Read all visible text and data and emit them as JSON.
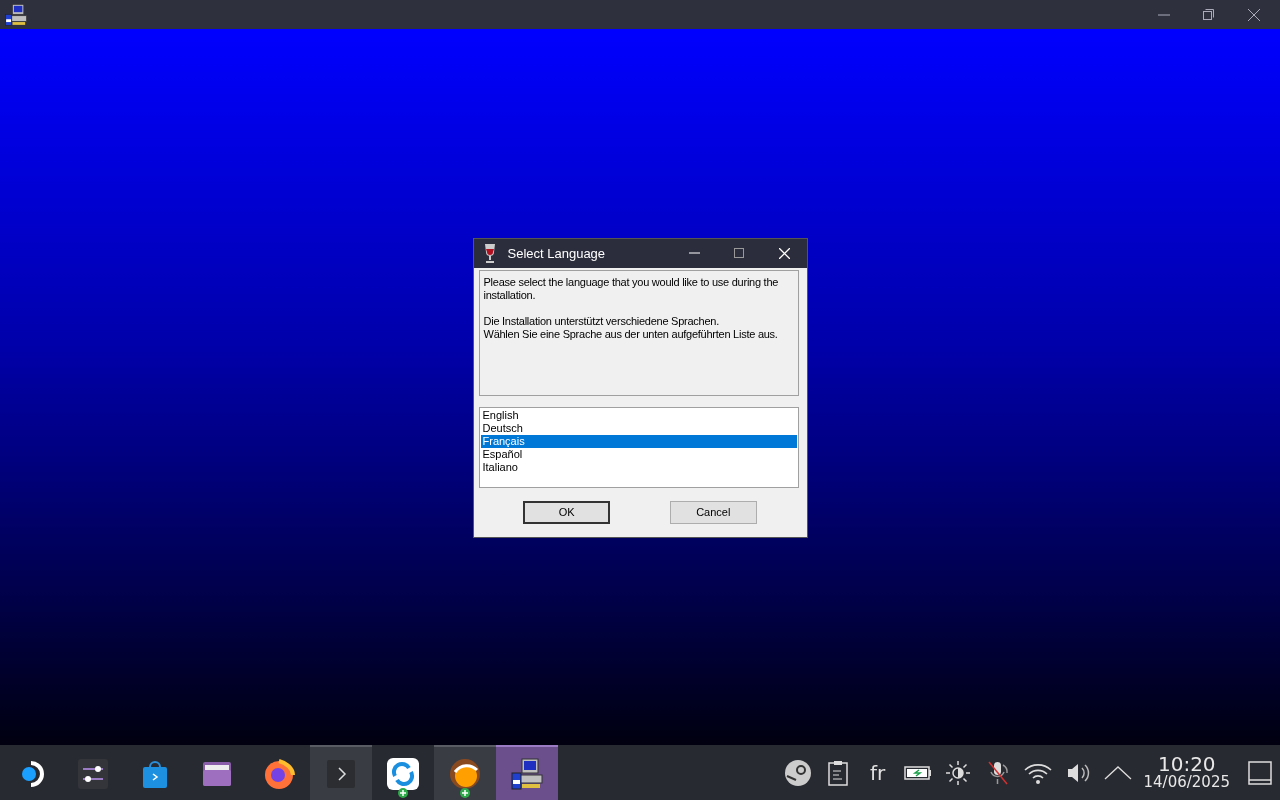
{
  "dialog": {
    "title": "Select Language",
    "message": [
      "Please select the language that you would like to use during the installation.",
      "Die Installation unterstützt verschiedene Sprachen.\nWählen Sie eine Sprache aus der unten aufgeführten Liste aus."
    ],
    "languages": [
      {
        "label": "English",
        "selected": false
      },
      {
        "label": "Deutsch",
        "selected": false
      },
      {
        "label": "Français",
        "selected": true
      },
      {
        "label": "Español",
        "selected": false
      },
      {
        "label": "Italiano",
        "selected": false
      }
    ],
    "buttons": [
      {
        "label": "OK",
        "default": true
      },
      {
        "label": "Cancel",
        "default": false
      }
    ]
  },
  "taskbar": {
    "apps": [
      {
        "kind": "launcher",
        "selected": false,
        "highlighted": false,
        "badge": false
      },
      {
        "kind": "settings",
        "selected": false,
        "highlighted": false,
        "badge": false
      },
      {
        "kind": "store",
        "selected": false,
        "highlighted": false,
        "badge": false
      },
      {
        "kind": "folder",
        "selected": false,
        "highlighted": false,
        "badge": false
      },
      {
        "kind": "browser",
        "selected": false,
        "highlighted": false,
        "badge": false
      },
      {
        "kind": "terminal",
        "selected": false,
        "highlighted": true,
        "badge": false
      },
      {
        "kind": "sync",
        "selected": false,
        "highlighted": false,
        "badge": true
      },
      {
        "kind": "orange",
        "selected": false,
        "highlighted": true,
        "badge": true
      },
      {
        "kind": "installer",
        "selected": true,
        "highlighted": false,
        "badge": false
      }
    ],
    "language": "fr",
    "time": "10:20",
    "date": "14/06/2025"
  }
}
